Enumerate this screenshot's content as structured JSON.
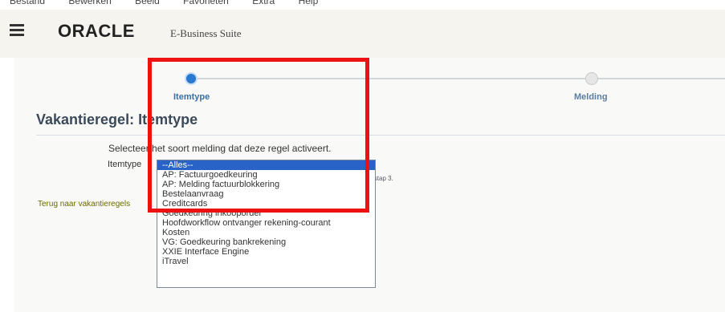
{
  "menubar": {
    "items": [
      "Bestand",
      "Bewerken",
      "Beeld",
      "Favorieten",
      "Extra",
      "Help"
    ]
  },
  "header": {
    "brand": "ORACLE",
    "brand_suffix": "E-Business Suite"
  },
  "train": {
    "steps": [
      "Itemtype",
      "Melding"
    ]
  },
  "page": {
    "title": "Vakantieregel: Itemtype",
    "instruction": "Selecteer het soort melding dat deze regel activeert.",
    "field_label": "Itemtype",
    "hint": "ij stap 3.",
    "back_link": "Terug naar vakantieregels"
  },
  "dropdown": {
    "options": [
      "--Alles--",
      "AP: Factuurgoedkeuring",
      "AP: Melding factuurblokkering",
      "Bestelaanvraag",
      "Creditcards",
      "Goedkeuring inkooporder",
      "Hoofdworkflow ontvanger rekening-courant",
      "Kosten",
      "VG: Goedkeuring bankrekening",
      "XXIE Interface Engine",
      "iTravel"
    ]
  },
  "colors": {
    "highlight": "#ee1111",
    "selection": "#2a63c8",
    "step_active": "#2a79d0"
  }
}
